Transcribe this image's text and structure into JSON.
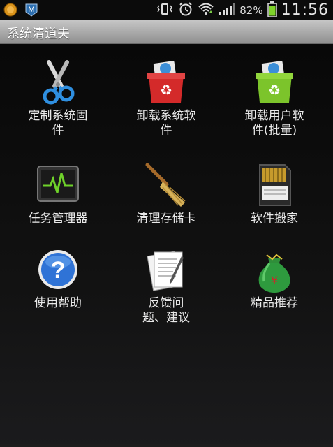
{
  "status_bar": {
    "left_icons": [
      "notification-dot-icon",
      "app-m-icon"
    ],
    "right_icons": [
      "vibrate-icon",
      "alarm-clock-icon",
      "wifi-icon",
      "signal-icon",
      "battery-icon"
    ],
    "battery_percent": "82%",
    "time": "11:56"
  },
  "title_bar": {
    "title": "系统清道夫"
  },
  "grid": {
    "items": [
      {
        "label": "定制系统固\n件",
        "icon": "scissors-icon"
      },
      {
        "label": "卸载系统软\n件",
        "icon": "red-recycle-bin-icon"
      },
      {
        "label": "卸载用户软\n件(批量)",
        "icon": "green-recycle-bin-icon"
      },
      {
        "label": "任务管理器",
        "icon": "heartbeat-monitor-icon"
      },
      {
        "label": "清理存储卡",
        "icon": "broom-icon"
      },
      {
        "label": "软件搬家",
        "icon": "sd-card-icon"
      },
      {
        "label": "使用帮助",
        "icon": "help-question-icon"
      },
      {
        "label": "反馈问\n题、建议",
        "icon": "feedback-document-icon"
      },
      {
        "label": "精品推荐",
        "icon": "money-bag-icon"
      }
    ]
  }
}
